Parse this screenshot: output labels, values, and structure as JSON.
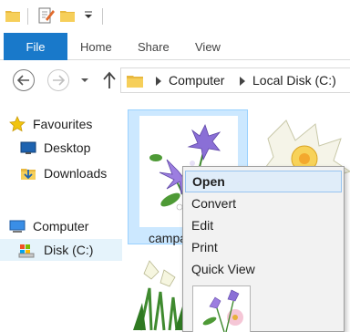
{
  "toolbar": {
    "icons": [
      "folder-icon",
      "properties-icon",
      "new-folder-icon",
      "customize-dropdown-icon"
    ]
  },
  "ribbon": {
    "tabs": [
      {
        "label": "File",
        "active": true
      },
      {
        "label": "Home"
      },
      {
        "label": "Share"
      },
      {
        "label": "View"
      }
    ],
    "accent": "#1979ca"
  },
  "address": {
    "segments": [
      "Computer",
      "Local Disk (C:)"
    ]
  },
  "navpane": {
    "items": [
      {
        "label": "Favourites",
        "icon": "star-icon"
      },
      {
        "label": "Desktop",
        "icon": "desktop-icon"
      },
      {
        "label": "Downloads",
        "icon": "downloads-icon"
      },
      {
        "label": "Computer",
        "icon": "computer-icon"
      },
      {
        "label": "Disk (C:)",
        "icon": "drive-icon",
        "selected": true
      }
    ]
  },
  "content": {
    "selected_file_label": "campa"
  },
  "context_menu": {
    "items": [
      {
        "label": "Open",
        "bold": true,
        "hover": true
      },
      {
        "label": "Convert"
      },
      {
        "label": "Edit"
      },
      {
        "label": "Print"
      },
      {
        "label": "Quick View"
      }
    ]
  }
}
